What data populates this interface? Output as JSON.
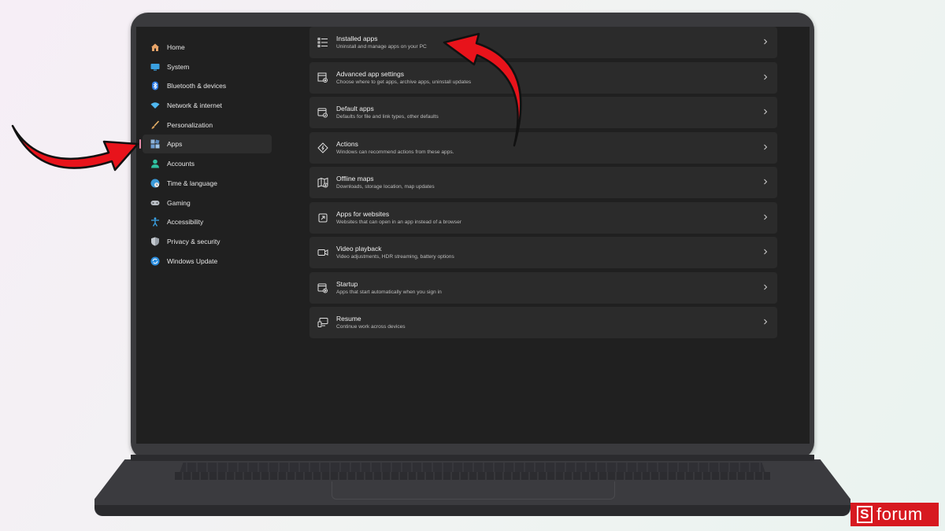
{
  "sidebar": {
    "items": [
      {
        "label": "Home",
        "icon": "home-icon"
      },
      {
        "label": "System",
        "icon": "monitor-icon"
      },
      {
        "label": "Bluetooth & devices",
        "icon": "bluetooth-icon"
      },
      {
        "label": "Network & internet",
        "icon": "wifi-icon"
      },
      {
        "label": "Personalization",
        "icon": "brush-icon"
      },
      {
        "label": "Apps",
        "icon": "apps-icon",
        "active": true
      },
      {
        "label": "Accounts",
        "icon": "person-icon"
      },
      {
        "label": "Time & language",
        "icon": "globe-clock-icon"
      },
      {
        "label": "Gaming",
        "icon": "controller-icon"
      },
      {
        "label": "Accessibility",
        "icon": "accessibility-icon"
      },
      {
        "label": "Privacy & security",
        "icon": "shield-icon"
      },
      {
        "label": "Windows Update",
        "icon": "update-icon"
      }
    ]
  },
  "settings": {
    "rows": [
      {
        "title": "Installed apps",
        "subtitle": "Uninstall and manage apps on your PC",
        "icon": "list-icon"
      },
      {
        "title": "Advanced app settings",
        "subtitle": "Choose where to get apps, archive apps, uninstall updates",
        "icon": "app-settings-icon"
      },
      {
        "title": "Default apps",
        "subtitle": "Defaults for file and link types, other defaults",
        "icon": "default-apps-icon"
      },
      {
        "title": "Actions",
        "subtitle": "Windows can recommend actions from these apps.",
        "icon": "actions-icon"
      },
      {
        "title": "Offline maps",
        "subtitle": "Downloads, storage location, map updates",
        "icon": "map-icon"
      },
      {
        "title": "Apps for websites",
        "subtitle": "Websites that can open in an app instead of a browser",
        "icon": "open-link-icon"
      },
      {
        "title": "Video playback",
        "subtitle": "Video adjustments, HDR streaming, battery options",
        "icon": "video-icon"
      },
      {
        "title": "Startup",
        "subtitle": "Apps that start automatically when you sign in",
        "icon": "startup-icon"
      },
      {
        "title": "Resume",
        "subtitle": "Continue work across devices",
        "icon": "resume-icon"
      }
    ]
  },
  "brand": {
    "logo_letter": "S",
    "name": "forum"
  },
  "colors": {
    "accent": "#e58aa8",
    "arrow": "#e8131b",
    "brand": "#d71920"
  }
}
